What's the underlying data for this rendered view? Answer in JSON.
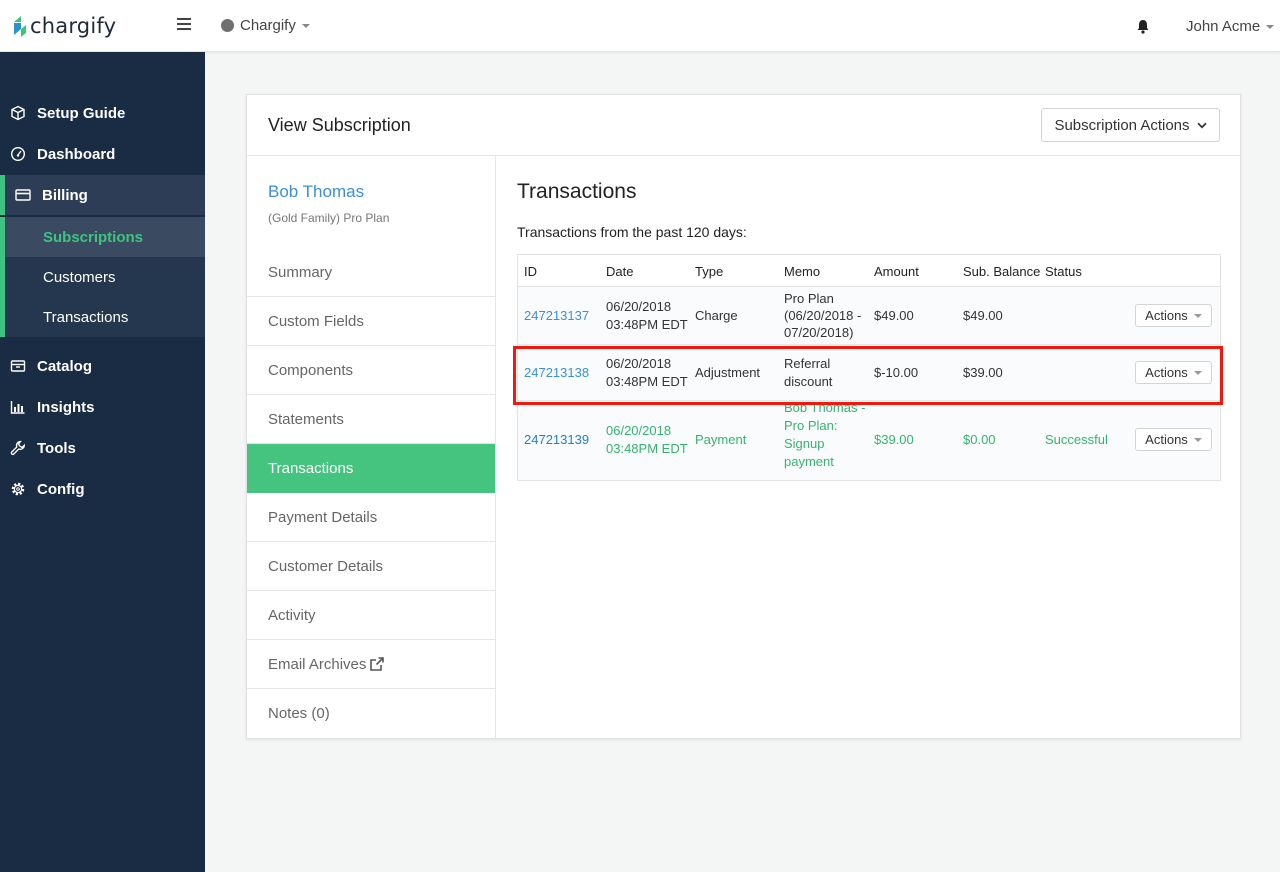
{
  "brand": {
    "logo_text": "chargify",
    "accent": "#3fc380",
    "sidebar_bg": "#1a2b44",
    "highlight": "#f2180c"
  },
  "topbar": {
    "site_name": "Chargify",
    "user_name": "John Acme"
  },
  "sidebar": {
    "items": [
      {
        "label": "Setup Guide",
        "icon": "cube-icon"
      },
      {
        "label": "Dashboard",
        "icon": "gauge-icon"
      },
      {
        "label": "Billing",
        "icon": "credit-card-icon"
      },
      {
        "label": "Catalog",
        "icon": "box-icon"
      },
      {
        "label": "Insights",
        "icon": "bar-chart-icon"
      },
      {
        "label": "Tools",
        "icon": "wrench-icon"
      },
      {
        "label": "Config",
        "icon": "gear-icon"
      }
    ],
    "billing_sub": [
      "Subscriptions",
      "Customers",
      "Transactions"
    ]
  },
  "card": {
    "title": "View Subscription",
    "actions_label": "Subscription Actions",
    "customer_name": "Bob Thomas",
    "plan": "(Gold Family) Pro Plan",
    "menu": [
      "Summary",
      "Custom Fields",
      "Components",
      "Statements",
      "Transactions",
      "Payment Details",
      "Customer Details",
      "Activity",
      "Email Archives",
      "Notes (0)"
    ]
  },
  "transactions": {
    "title": "Transactions",
    "subtitle": "Transactions from the past 120 days:",
    "headers": [
      "ID",
      "Date",
      "Type",
      "Memo",
      "Amount",
      "Sub. Balance",
      "Status"
    ],
    "action_label": "Actions",
    "rows": [
      {
        "id": "247213137",
        "date": "06/20/2018",
        "time": "03:48PM EDT",
        "type": "Charge",
        "memo": [
          "Pro Plan",
          "(06/20/2018 -",
          "07/20/2018)"
        ],
        "amount": "$49.00",
        "balance": "$49.00",
        "status": ""
      },
      {
        "id": "247213138",
        "date": "06/20/2018",
        "time": "03:48PM EDT",
        "type": "Adjustment",
        "memo": [
          "Referral",
          "discount"
        ],
        "amount": "$-10.00",
        "balance": "$39.00",
        "status": ""
      },
      {
        "id": "247213139",
        "date": "06/20/2018",
        "time": "03:48PM EDT",
        "type": "Payment",
        "memo": [
          "Bob Thomas -",
          "Pro Plan:",
          "Signup",
          "payment"
        ],
        "amount": "$39.00",
        "balance": "$0.00",
        "status": "Successful"
      }
    ]
  }
}
